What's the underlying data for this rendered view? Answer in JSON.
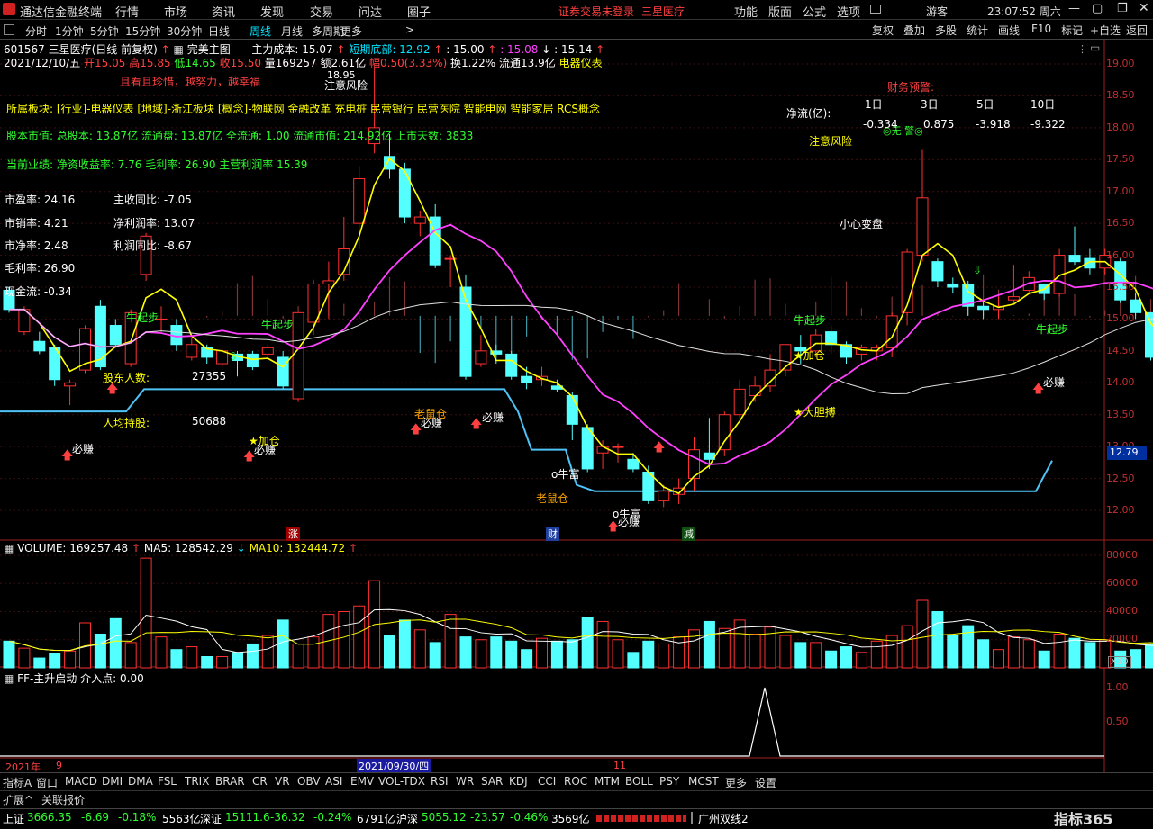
{
  "app": {
    "title": "通达信金融终端",
    "menus": [
      "行情",
      "市场",
      "资讯",
      "发现",
      "交易",
      "问达",
      "圈子"
    ],
    "notice": "证券交易未登录",
    "stock_name_red": "三星医疗",
    "right_menus": [
      "功能",
      "版面",
      "公式",
      "选项"
    ],
    "user": "游客",
    "clock": "23:07:52 周六"
  },
  "toolbar": {
    "periods": [
      "分时",
      "1分钟",
      "5分钟",
      "15分钟",
      "30分钟",
      "日线",
      "周线",
      "月线",
      "多周期",
      "更多"
    ],
    "active_period": "日线",
    "right_buttons": [
      "复权",
      "叠加",
      "多股",
      "统计",
      "画线",
      "F10",
      "标记",
      "+自选",
      "返回"
    ]
  },
  "chart_header": {
    "code_name": "601567 三星医疗(日线 前复权)",
    "main_chart": "完美主图",
    "cost": "主力成本: 15.07",
    "short_bottom": "短期底部: 12.92",
    "v1": ": 15.00",
    "v2": ": 15.08",
    "v3": ": 15.14",
    "date": "2021/12/10/五",
    "open": "开15.05",
    "high": "高15.85",
    "low": "低14.65",
    "close": "收15.50",
    "volume": "量169257",
    "amount": "额2.61亿",
    "change": "幅0.50(3.33%)",
    "turnover": "换1.22%",
    "float_val": "流通13.9亿",
    "industry": "电器仪表"
  },
  "info_overlay": {
    "motto": "且看且珍惜，越努力，越幸福",
    "sector": "所属板块: [行业]-电器仪表 [地域]-浙江板块 [概念]-物联网 金融改革 充电桩 民营银行 民营医院 智能电网 智能家居 RCS概念",
    "equity": "股本市值: 总股本: 13.87亿 流通盘: 13.87亿 全流通: 1.00 流通市值: 214.92亿 上市天数: 3833",
    "performance": "当前业绩: 净资收益率: 7.76 毛利率: 26.90 主营利润率 15.39",
    "ratios_left": [
      "市盈率: 24.16",
      "市销率: 4.21",
      "市净率: 2.48",
      "毛利率: 26.90",
      "现金流: -0.34"
    ],
    "ratios_right": [
      "主收同比: -7.05",
      "净利润率: 13.07",
      "利润同比: -8.67"
    ],
    "shareholders_label": "股东人数:",
    "shareholders": "27355",
    "per_capita_label": "人均持股:",
    "per_capita": "50688",
    "finance_warning": "财务预警:",
    "netflow_label": "净流(亿):",
    "netflow_headers": [
      "1日",
      "3日",
      "5日",
      "10日"
    ],
    "netflow_values": [
      "-0.334",
      "0.875",
      "-3.918",
      "-9.322"
    ],
    "no_warning": "◎无 警◎"
  },
  "annotations": {
    "bi_zhuan": "必赚",
    "jia_cang": "★加仓",
    "niu_qi_bu": "牛起步",
    "lao_shu_cang": "老鼠仓",
    "zhu_yi_feng_xian": "注意风险",
    "xiao_xin_bian_pan": "小心变盘",
    "da_dan_bo": "★大胆搏",
    "niu_fu": "o牛富",
    "peak_price": "18.95",
    "zhang": "涨",
    "cai": "财",
    "jian": "减"
  },
  "price_axis": [
    "19.00",
    "18.50",
    "18.00",
    "17.50",
    "17.00",
    "16.50",
    "16.00",
    "15.50",
    "15.00",
    "14.50",
    "14.00",
    "13.50",
    "13.00",
    "12.50",
    "12.00"
  ],
  "current_price_tag": "12.79",
  "volume_panel": {
    "label": "VOLUME: 169257.48",
    "ma5": "MA5: 128542.29",
    "ma10": "MA10: 132444.72",
    "axis": [
      "80000",
      "60000",
      "40000",
      "20000"
    ],
    "unit": "X10"
  },
  "indicator_panel": {
    "label": "FF-主升启动",
    "value": "介入点: 0.00",
    "axis": [
      "1.00",
      "0.50"
    ]
  },
  "date_axis": {
    "year": "2021年",
    "m9": "9",
    "cursor_date": "2021/09/30/四",
    "m11": "11"
  },
  "indicator_tabs": [
    "指标A",
    "窗口",
    "MACD",
    "DMI",
    "DMA",
    "FSL",
    "TRIX",
    "BRAR",
    "CR",
    "VR",
    "OBV",
    "ASI",
    "EMV",
    "VOL-TDX",
    "RSI",
    "WR",
    "SAR",
    "KDJ",
    "CCI",
    "ROC",
    "MTM",
    "BOLL",
    "PSY",
    "MCST",
    "更多",
    "设置"
  ],
  "sub_tabs": [
    "扩展^",
    "关联报价"
  ],
  "status": {
    "sh_label": "上证",
    "sh_val": "3666.35",
    "sh_chg": "-6.69",
    "sh_pct": "-0.18%",
    "sh_amt": "5563亿",
    "sz_label": "深证",
    "sz_val": "15111.6",
    "sz_chg": "-36.32",
    "sz_pct": "-0.24%",
    "sz_amt": "6791亿",
    "hs_label": "沪深",
    "hs_val": "5055.12",
    "hs_chg": "-23.57",
    "hs_pct": "-0.46%",
    "hs_amt": "3569亿",
    "server": "广州双线2",
    "brand": "指标365"
  },
  "candles": [
    [
      15.45,
      15.15,
      15.5,
      15.1
    ],
    [
      14.8,
      15.15,
      15.2,
      14.75
    ],
    [
      14.65,
      14.5,
      14.8,
      14.45
    ],
    [
      14.55,
      14.05,
      14.6,
      13.95
    ],
    [
      13.95,
      14.0,
      14.05,
      13.65
    ],
    [
      14.2,
      14.85,
      14.9,
      14.15
    ],
    [
      15.2,
      14.25,
      15.3,
      14.2
    ],
    [
      14.9,
      14.6,
      15.0,
      14.55
    ],
    [
      14.3,
      15.1,
      15.15,
      14.25
    ],
    [
      15.7,
      16.3,
      16.35,
      15.6
    ],
    [
      15.0,
      15.0,
      15.2,
      14.8
    ],
    [
      14.9,
      14.6,
      15.0,
      14.5
    ],
    [
      14.4,
      14.6,
      14.7,
      14.35
    ],
    [
      14.55,
      14.4,
      14.6,
      14.3
    ],
    [
      14.3,
      14.5,
      14.55,
      14.25
    ],
    [
      14.45,
      14.35,
      14.5,
      14.1
    ],
    [
      14.45,
      14.25,
      14.5,
      14.2
    ],
    [
      14.45,
      14.55,
      14.6,
      14.35
    ],
    [
      14.4,
      13.95,
      14.5,
      13.9
    ],
    [
      13.75,
      15.1,
      15.1,
      13.7
    ],
    [
      14.95,
      15.55,
      15.6,
      14.75
    ],
    [
      15.55,
      15.6,
      15.9,
      15.0
    ],
    [
      15.7,
      16.1,
      16.6,
      15.6
    ],
    [
      16.5,
      17.2,
      17.4,
      16.1
    ],
    [
      17.75,
      18.0,
      18.95,
      17.6
    ],
    [
      17.55,
      17.35,
      17.9,
      17.2
    ],
    [
      17.35,
      16.6,
      17.45,
      16.5
    ],
    [
      16.5,
      16.6,
      16.7,
      16.3
    ],
    [
      16.6,
      15.85,
      16.8,
      15.8
    ],
    [
      15.95,
      15.95,
      16.0,
      15.5
    ],
    [
      15.5,
      14.1,
      15.7,
      14.05
    ],
    [
      14.3,
      14.5,
      14.75,
      14.25
    ],
    [
      14.5,
      14.45,
      14.6,
      14.3
    ],
    [
      14.45,
      14.1,
      14.5,
      14.05
    ],
    [
      14.1,
      14.0,
      14.25,
      13.9
    ],
    [
      14.05,
      14.1,
      14.25,
      13.95
    ],
    [
      13.95,
      13.9,
      14.05,
      13.85
    ],
    [
      13.8,
      13.35,
      13.85,
      13.1
    ],
    [
      13.3,
      12.65,
      13.35,
      12.6
    ],
    [
      12.9,
      13.0,
      13.1,
      12.65
    ],
    [
      13.0,
      13.0,
      13.05,
      12.75
    ],
    [
      12.8,
      12.65,
      12.9,
      12.6
    ],
    [
      12.6,
      12.15,
      12.7,
      12.1
    ],
    [
      12.15,
      12.3,
      12.4,
      12.05
    ],
    [
      12.25,
      12.35,
      12.5,
      12.1
    ],
    [
      12.5,
      12.95,
      13.15,
      12.3
    ],
    [
      12.9,
      12.8,
      13.45,
      12.65
    ],
    [
      12.95,
      13.5,
      13.55,
      12.85
    ],
    [
      13.5,
      13.9,
      14.05,
      13.45
    ],
    [
      13.8,
      13.95,
      14.1,
      13.7
    ],
    [
      13.95,
      14.2,
      14.45,
      13.85
    ],
    [
      14.2,
      14.6,
      14.6,
      14.1
    ],
    [
      14.55,
      14.5,
      14.75,
      14.3
    ],
    [
      14.5,
      14.75,
      14.85,
      14.4
    ],
    [
      14.8,
      14.6,
      14.9,
      14.45
    ],
    [
      14.6,
      14.4,
      14.65,
      14.3
    ],
    [
      14.45,
      14.55,
      14.6,
      14.35
    ],
    [
      14.5,
      14.55,
      14.6,
      14.35
    ],
    [
      14.55,
      15.05,
      15.1,
      14.4
    ],
    [
      15.1,
      16.05,
      16.1,
      14.9
    ],
    [
      16.0,
      16.9,
      17.65,
      15.9
    ],
    [
      15.9,
      15.6,
      15.95,
      15.5
    ],
    [
      15.55,
      15.5,
      15.65,
      15.4
    ],
    [
      15.55,
      15.2,
      15.6,
      15.05
    ],
    [
      15.2,
      15.15,
      15.3,
      15.0
    ],
    [
      15.15,
      15.2,
      15.35,
      15.0
    ],
    [
      15.3,
      15.35,
      15.85,
      15.25
    ],
    [
      15.45,
      15.65,
      15.75,
      15.4
    ],
    [
      15.55,
      15.4,
      15.55,
      15.3
    ],
    [
      15.4,
      16.0,
      16.1,
      15.35
    ],
    [
      16.0,
      15.9,
      16.45,
      15.85
    ],
    [
      15.95,
      15.8,
      16.1,
      15.7
    ],
    [
      15.8,
      16.0,
      16.1,
      15.7
    ],
    [
      15.9,
      15.3,
      15.95,
      15.25
    ],
    [
      15.3,
      15.1,
      15.4,
      15.0
    ],
    [
      15.1,
      14.4,
      15.1,
      14.35
    ],
    [
      14.4,
      14.55,
      14.6,
      14.15
    ],
    [
      14.55,
      14.4,
      14.6,
      14.3
    ],
    [
      14.4,
      14.6,
      14.75,
      14.35
    ],
    [
      14.65,
      15.0,
      15.1,
      14.55
    ],
    [
      15.05,
      15.5,
      15.85,
      14.65
    ]
  ],
  "volumes": [
    19000,
    14000,
    7000,
    10000,
    12000,
    32000,
    24000,
    35000,
    18000,
    78000,
    22000,
    13000,
    15000,
    8000,
    8000,
    11000,
    17000,
    23000,
    34000,
    17000,
    22000,
    38000,
    40000,
    44000,
    62000,
    23000,
    34000,
    27000,
    18000,
    38000,
    22000,
    20000,
    22000,
    19000,
    13000,
    21000,
    19000,
    20000,
    36000,
    33000,
    20000,
    11000,
    19000,
    17000,
    22000,
    27000,
    33000,
    28000,
    34000,
    24000,
    29000,
    23000,
    18000,
    18000,
    12000,
    15000,
    11000,
    19000,
    23000,
    30000,
    48000,
    40000,
    23000,
    30000,
    20000,
    13000,
    22000,
    20000,
    12000,
    24000,
    21000,
    18000,
    20000,
    12000,
    13000,
    17000,
    10000,
    14000,
    10000,
    14000,
    16000
  ],
  "ff_indicator": [
    0,
    0,
    0,
    0,
    0,
    0,
    0,
    0,
    0,
    0,
    0,
    0,
    0,
    0,
    0,
    0,
    0,
    0,
    0,
    0,
    0,
    0,
    0,
    0,
    0,
    0,
    0,
    0,
    0,
    0,
    0,
    0,
    0,
    0,
    0,
    0,
    0,
    0,
    0,
    0,
    0,
    0,
    0,
    0,
    0,
    0,
    0,
    0,
    0,
    0,
    0,
    0,
    0,
    0,
    0,
    0,
    0,
    0,
    0,
    0,
    0,
    0,
    0,
    0,
    0,
    0,
    0,
    0,
    0,
    0,
    0,
    0,
    0,
    0,
    0,
    0,
    0,
    0,
    0,
    0,
    0
  ]
}
